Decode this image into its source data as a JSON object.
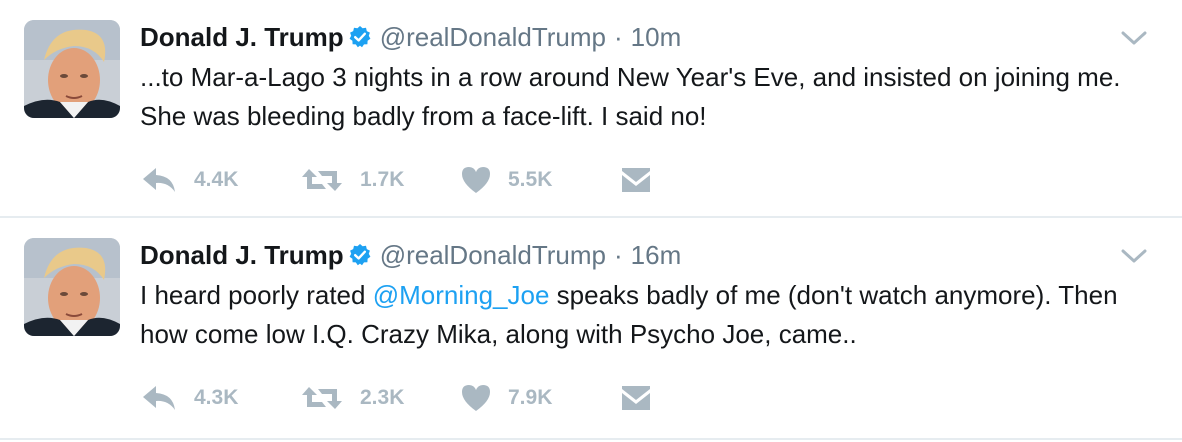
{
  "colors": {
    "link": "#1da1f2",
    "muted": "#657786",
    "action": "#aab8c2",
    "divider": "#e6ecf0"
  },
  "icons": [
    "verified-badge-icon",
    "chevron-down-icon",
    "reply-icon",
    "retweet-icon",
    "heart-icon",
    "envelope-icon"
  ],
  "tweets": [
    {
      "name": "Donald J. Trump",
      "handle": "@realDonaldTrump",
      "separator": "·",
      "time": "10m",
      "text_before": "...to Mar-a-Lago 3 nights in a row around New Year's Eve, and insisted on joining me. She was bleeding badly from a face-lift. I said no!",
      "mention": "",
      "text_after": "",
      "replies": "4.4K",
      "retweets": "1.7K",
      "likes": "5.5K"
    },
    {
      "name": "Donald J. Trump",
      "handle": "@realDonaldTrump",
      "separator": "·",
      "time": "16m",
      "text_before": "I heard poorly rated ",
      "mention": "@Morning_Joe",
      "text_after": " speaks badly of me (don't watch anymore). Then how come low I.Q. Crazy Mika, along with Psycho Joe, came..",
      "replies": "4.3K",
      "retweets": "2.3K",
      "likes": "7.9K"
    }
  ]
}
